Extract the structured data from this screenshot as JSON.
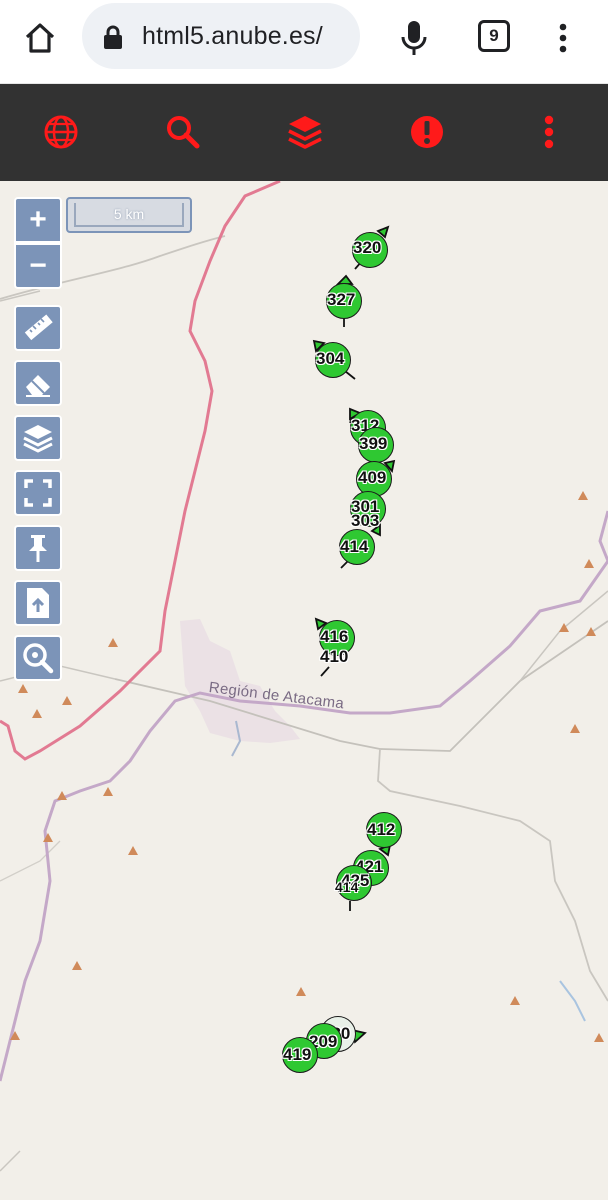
{
  "browser": {
    "url": "html5.anube.es/",
    "tab_count": "9"
  },
  "toolbar": {
    "accent_color": "#ff1a1a",
    "buttons": [
      "globe-icon",
      "search-icon",
      "layers-icon",
      "alert-icon",
      "more-vert-icon"
    ]
  },
  "map": {
    "scale_label": "5 km",
    "region_label": "Región de Atacama",
    "controls": [
      "zoom-in",
      "zoom-out",
      "ruler",
      "eraser",
      "layers",
      "fullscreen",
      "pin",
      "upload-file",
      "zoom-search"
    ],
    "zoom_in_label": "+",
    "zoom_out_label": "−",
    "station_color": "#2fc832",
    "stations": [
      "320",
      "327",
      "304",
      "312",
      "399",
      "409",
      "301",
      "303",
      "414",
      "416",
      "410",
      "412",
      "421",
      "425",
      "414",
      "430",
      "209",
      "419"
    ]
  }
}
